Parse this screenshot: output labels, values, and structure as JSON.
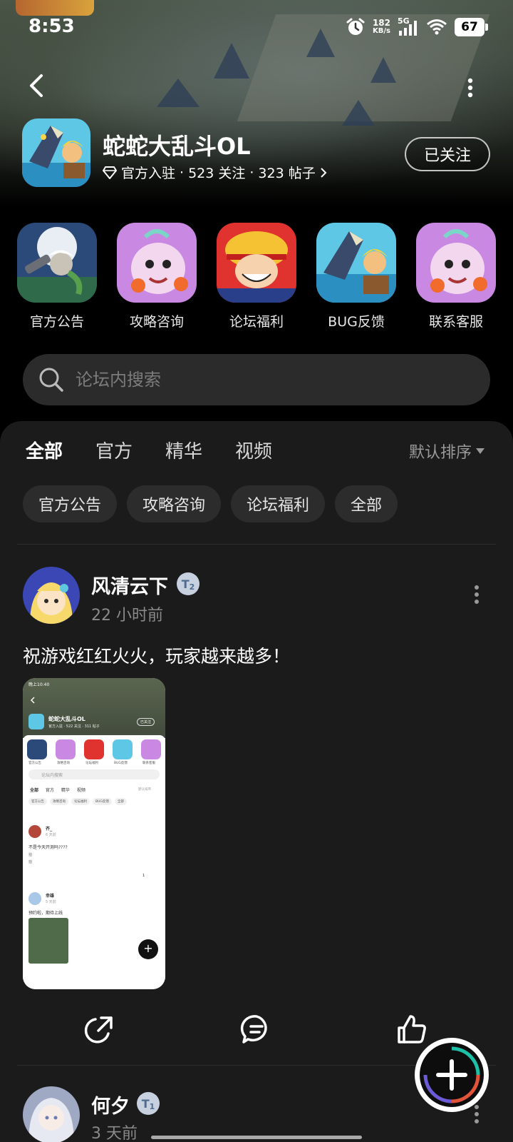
{
  "status_bar": {
    "time": "8:53",
    "net_speed_value": "182",
    "net_speed_unit": "KB/s",
    "signal_label": "5G",
    "battery": "67"
  },
  "forum": {
    "title": "蛇蛇大乱斗OL",
    "official_label": "官方入驻",
    "followers": "523 关注",
    "posts": "323 帖子",
    "separator": "·",
    "follow_button": "已关注"
  },
  "quick_entries": [
    {
      "label": "官方公告"
    },
    {
      "label": "攻略咨询"
    },
    {
      "label": "论坛福利"
    },
    {
      "label": "BUG反馈"
    },
    {
      "label": "联系客服"
    }
  ],
  "search": {
    "placeholder": "论坛内搜索"
  },
  "tabs": [
    {
      "label": "全部"
    },
    {
      "label": "官方"
    },
    {
      "label": "精华"
    },
    {
      "label": "视频"
    }
  ],
  "sort_label": "默认排序",
  "chips": [
    {
      "label": "官方公告"
    },
    {
      "label": "攻略咨询"
    },
    {
      "label": "论坛福利"
    },
    {
      "label": "全部"
    }
  ],
  "posts": [
    {
      "author": "风清云下",
      "level": "2",
      "time": "22 小时前",
      "text": "祝游戏红红火火，玩家越来越多！"
    },
    {
      "author": "何夕",
      "level": "1",
      "time": "3 天前"
    }
  ],
  "thumbnail": {
    "status_time": "晚上10:40",
    "title": "蛇蛇大乱斗OL",
    "meta": "官方入驻 · 522 关注 · 311 帖子",
    "follow": "已关注",
    "entries": [
      "官方公告",
      "攻略咨询",
      "论坛福利",
      "BUG反馈",
      "联系客服"
    ],
    "search": "论坛内搜索",
    "tabs": [
      "全部",
      "官方",
      "精华",
      "视频"
    ],
    "sort": "默认排序",
    "chips": [
      "官方公告",
      "攻略咨询",
      "论坛福利",
      "BUG反馈",
      "全部"
    ],
    "post1_author": "齐_",
    "post1_time": "6 天前",
    "post1_text": "不是今天开测吗????",
    "post1_line2": "拍",
    "post1_line3": "拍",
    "post1_likes": "1",
    "post2_author": "幸雄",
    "post2_time": "5 天前",
    "post2_text": "预约啦，期待上线"
  },
  "colors": {
    "accent": "#1dbfa7",
    "sheet_bg": "#1b1b1b",
    "chip_bg": "#2c2c2c"
  }
}
